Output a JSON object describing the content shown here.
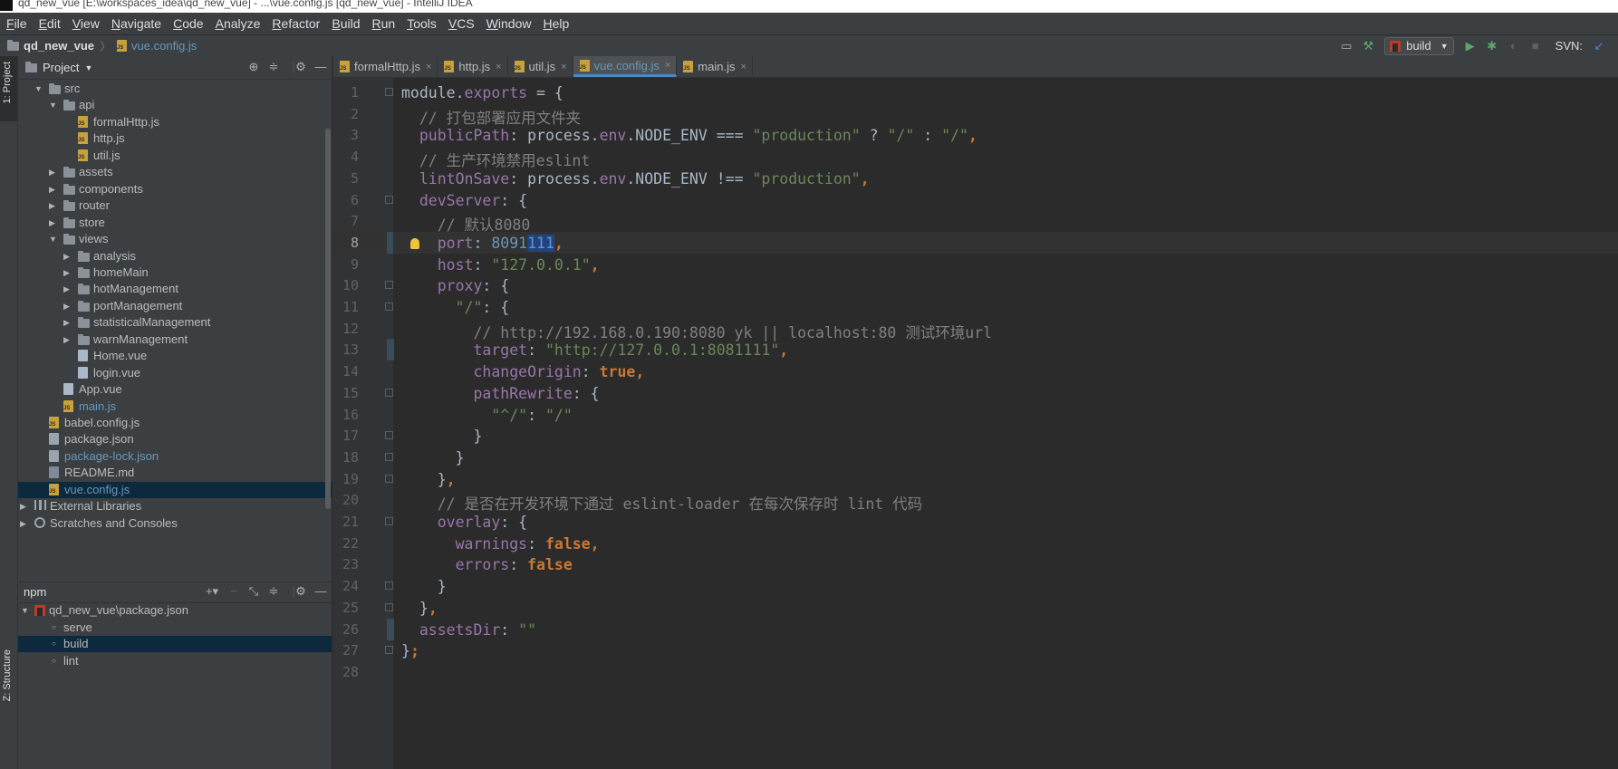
{
  "window": {
    "title": "qd_new_vue [E:\\workspaces_idea\\qd_new_vue] - ...\\vue.config.js [qd_new_vue] - IntelliJ IDEA"
  },
  "menu": [
    {
      "label": "File",
      "u": "F",
      "rest": "ile"
    },
    {
      "label": "Edit",
      "u": "E",
      "rest": "dit"
    },
    {
      "label": "View",
      "u": "V",
      "rest": "iew"
    },
    {
      "label": "Navigate",
      "u": "N",
      "rest": "avigate"
    },
    {
      "label": "Code",
      "u": "C",
      "rest": "ode"
    },
    {
      "label": "Analyze",
      "u": "A",
      "rest": "nalyze"
    },
    {
      "label": "Refactor",
      "u": "R",
      "rest": "efactor"
    },
    {
      "label": "Build",
      "u": "B",
      "rest": "uild"
    },
    {
      "label": "Run",
      "u": "R",
      "rest": "un"
    },
    {
      "label": "Tools",
      "u": "T",
      "rest": "ools"
    },
    {
      "label": "VCS",
      "u": "V",
      "rest": "CS"
    },
    {
      "label": "Window",
      "u": "W",
      "rest": "indow"
    },
    {
      "label": "Help",
      "u": "H",
      "rest": "elp"
    }
  ],
  "breadcrumb": {
    "project": "qd_new_vue",
    "file": "vue.config.js"
  },
  "toolbar": {
    "run_config": "build",
    "svn_label": "SVN:"
  },
  "side_tabs": {
    "project": "1: Project",
    "structure": "Z: Structure"
  },
  "project_panel": {
    "title": "Project",
    "tree": [
      {
        "label": "src",
        "depth": 0,
        "type": "folder",
        "open": true
      },
      {
        "label": "api",
        "depth": 1,
        "type": "folder",
        "open": true
      },
      {
        "label": "formalHttp.js",
        "depth": 2,
        "type": "js"
      },
      {
        "label": "http.js",
        "depth": 2,
        "type": "js"
      },
      {
        "label": "util.js",
        "depth": 2,
        "type": "js"
      },
      {
        "label": "assets",
        "depth": 1,
        "type": "folder",
        "open": false
      },
      {
        "label": "components",
        "depth": 1,
        "type": "folder",
        "open": false
      },
      {
        "label": "router",
        "depth": 1,
        "type": "folder",
        "open": false
      },
      {
        "label": "store",
        "depth": 1,
        "type": "folder",
        "open": false
      },
      {
        "label": "views",
        "depth": 1,
        "type": "folder",
        "open": true
      },
      {
        "label": "analysis",
        "depth": 2,
        "type": "folder",
        "open": false
      },
      {
        "label": "homeMain",
        "depth": 2,
        "type": "folder",
        "open": false
      },
      {
        "label": "hotManagement",
        "depth": 2,
        "type": "folder",
        "open": false
      },
      {
        "label": "portManagement",
        "depth": 2,
        "type": "folder",
        "open": false
      },
      {
        "label": "statisticalManagement",
        "depth": 2,
        "type": "folder",
        "open": false
      },
      {
        "label": "warnManagement",
        "depth": 2,
        "type": "folder",
        "open": false
      },
      {
        "label": "Home.vue",
        "depth": 2,
        "type": "vue"
      },
      {
        "label": "login.vue",
        "depth": 2,
        "type": "vue"
      },
      {
        "label": "App.vue",
        "depth": 1,
        "type": "vue"
      },
      {
        "label": "main.js",
        "depth": 1,
        "type": "js",
        "modified": true
      },
      {
        "label": "babel.config.js",
        "depth": 0,
        "type": "js"
      },
      {
        "label": "package.json",
        "depth": 0,
        "type": "json"
      },
      {
        "label": "package-lock.json",
        "depth": 0,
        "type": "json",
        "modified": true
      },
      {
        "label": "README.md",
        "depth": 0,
        "type": "md"
      },
      {
        "label": "vue.config.js",
        "depth": 0,
        "type": "js",
        "modified": true,
        "selected": true
      },
      {
        "label": "External Libraries",
        "depth": -1,
        "type": "lib",
        "open": false
      },
      {
        "label": "Scratches and Consoles",
        "depth": -1,
        "type": "scratch",
        "open": false
      }
    ]
  },
  "npm_panel": {
    "title": "npm",
    "package": "qd_new_vue\\package.json",
    "scripts": [
      {
        "label": "serve",
        "selected": false
      },
      {
        "label": "build",
        "selected": true
      },
      {
        "label": "lint",
        "selected": false
      }
    ]
  },
  "editor_tabs": [
    {
      "label": "formalHttp.js",
      "active": false
    },
    {
      "label": "http.js",
      "active": false
    },
    {
      "label": "util.js",
      "active": false
    },
    {
      "label": "vue.config.js",
      "active": true
    },
    {
      "label": "main.js",
      "active": false
    }
  ],
  "code": {
    "current_line": 8,
    "lines": [
      [
        {
          "t": "module",
          "c": ""
        },
        {
          "t": ".",
          "c": ""
        },
        {
          "t": "exports",
          "c": "prop"
        },
        {
          "t": " = {",
          "c": ""
        }
      ],
      [
        {
          "t": "  // 打包部署应用文件夹",
          "c": "cm"
        }
      ],
      [
        {
          "t": "  ",
          "c": ""
        },
        {
          "t": "publicPath",
          "c": "prop"
        },
        {
          "t": ": process.",
          "c": ""
        },
        {
          "t": "env",
          "c": "prop"
        },
        {
          "t": ".NODE_ENV === ",
          "c": ""
        },
        {
          "t": "\"production\"",
          "c": "str"
        },
        {
          "t": " ? ",
          "c": ""
        },
        {
          "t": "\"/\"",
          "c": "str"
        },
        {
          "t": " : ",
          "c": ""
        },
        {
          "t": "\"/\"",
          "c": "str"
        },
        {
          "t": ",",
          "c": "kw"
        }
      ],
      [
        {
          "t": "  // 生产环境禁用eslint",
          "c": "cm"
        }
      ],
      [
        {
          "t": "  ",
          "c": ""
        },
        {
          "t": "lintOnSave",
          "c": "prop"
        },
        {
          "t": ": process.",
          "c": ""
        },
        {
          "t": "env",
          "c": "prop"
        },
        {
          "t": ".NODE_ENV !== ",
          "c": ""
        },
        {
          "t": "\"production\"",
          "c": "str"
        },
        {
          "t": ",",
          "c": "kw"
        }
      ],
      [
        {
          "t": "  ",
          "c": ""
        },
        {
          "t": "devServer",
          "c": "prop"
        },
        {
          "t": ": {",
          "c": ""
        }
      ],
      [
        {
          "t": "    // 默认8080",
          "c": "cm"
        }
      ],
      [
        {
          "t": "    ",
          "c": ""
        },
        {
          "t": "port",
          "c": "prop"
        },
        {
          "t": ": ",
          "c": ""
        },
        {
          "t": "8091",
          "c": "num"
        },
        {
          "t": "111",
          "c": "num sel-hl"
        },
        {
          "t": ",",
          "c": "kw"
        }
      ],
      [
        {
          "t": "    ",
          "c": ""
        },
        {
          "t": "host",
          "c": "prop"
        },
        {
          "t": ": ",
          "c": ""
        },
        {
          "t": "\"127.0.0.1\"",
          "c": "str"
        },
        {
          "t": ",",
          "c": "kw"
        }
      ],
      [
        {
          "t": "    ",
          "c": ""
        },
        {
          "t": "proxy",
          "c": "prop"
        },
        {
          "t": ": {",
          "c": ""
        }
      ],
      [
        {
          "t": "      ",
          "c": ""
        },
        {
          "t": "\"/\"",
          "c": "str"
        },
        {
          "t": ": {",
          "c": ""
        }
      ],
      [
        {
          "t": "        // http://192.168.0.190:8080 yk || localhost:80 测试环境url",
          "c": "cm"
        }
      ],
      [
        {
          "t": "        ",
          "c": ""
        },
        {
          "t": "target",
          "c": "prop"
        },
        {
          "t": ": ",
          "c": ""
        },
        {
          "t": "\"http://127.0.0.1:8081111\"",
          "c": "str"
        },
        {
          "t": ",",
          "c": "kw"
        }
      ],
      [
        {
          "t": "        ",
          "c": ""
        },
        {
          "t": "changeOrigin",
          "c": "prop"
        },
        {
          "t": ": ",
          "c": ""
        },
        {
          "t": "true",
          "c": "kw"
        },
        {
          "t": ",",
          "c": "kw"
        }
      ],
      [
        {
          "t": "        ",
          "c": ""
        },
        {
          "t": "pathRewrite",
          "c": "prop"
        },
        {
          "t": ": {",
          "c": ""
        }
      ],
      [
        {
          "t": "          ",
          "c": ""
        },
        {
          "t": "\"^/\"",
          "c": "str"
        },
        {
          "t": ": ",
          "c": ""
        },
        {
          "t": "\"/\"",
          "c": "str"
        }
      ],
      [
        {
          "t": "        }",
          "c": ""
        }
      ],
      [
        {
          "t": "      }",
          "c": ""
        }
      ],
      [
        {
          "t": "    }",
          "c": ""
        },
        {
          "t": ",",
          "c": "kw"
        }
      ],
      [
        {
          "t": "    // 是否在开发环境下通过 eslint-loader 在每次保存时 lint 代码",
          "c": "cm"
        }
      ],
      [
        {
          "t": "    ",
          "c": ""
        },
        {
          "t": "overlay",
          "c": "prop"
        },
        {
          "t": ": {",
          "c": ""
        }
      ],
      [
        {
          "t": "      ",
          "c": ""
        },
        {
          "t": "warnings",
          "c": "prop"
        },
        {
          "t": ": ",
          "c": ""
        },
        {
          "t": "false",
          "c": "kw"
        },
        {
          "t": ",",
          "c": "kw"
        }
      ],
      [
        {
          "t": "      ",
          "c": ""
        },
        {
          "t": "errors",
          "c": "prop"
        },
        {
          "t": ": ",
          "c": ""
        },
        {
          "t": "false",
          "c": "kw"
        }
      ],
      [
        {
          "t": "    }",
          "c": ""
        }
      ],
      [
        {
          "t": "  }",
          "c": ""
        },
        {
          "t": ",",
          "c": "kw"
        }
      ],
      [
        {
          "t": "  ",
          "c": ""
        },
        {
          "t": "assetsDir",
          "c": "prop"
        },
        {
          "t": ": ",
          "c": ""
        },
        {
          "t": "\"\"",
          "c": "str"
        }
      ],
      [
        {
          "t": "}",
          "c": ""
        },
        {
          "t": ";",
          "c": "kw"
        }
      ],
      [
        {
          "t": "",
          "c": ""
        }
      ]
    ]
  },
  "colors": {
    "accent": "#4a88c7",
    "selection": "#0d293e",
    "background": "#2b2b2b",
    "panel": "#3c3f41"
  },
  "icons": [
    "project-folder-icon",
    "js-file-icon",
    "json-file-icon",
    "vue-file-icon",
    "md-file-icon",
    "npm-icon",
    "run-icon",
    "debug-icon",
    "hammer-icon",
    "gear-icon",
    "minimize-icon",
    "target-icon",
    "collapse-icon",
    "lightbulb-icon"
  ]
}
